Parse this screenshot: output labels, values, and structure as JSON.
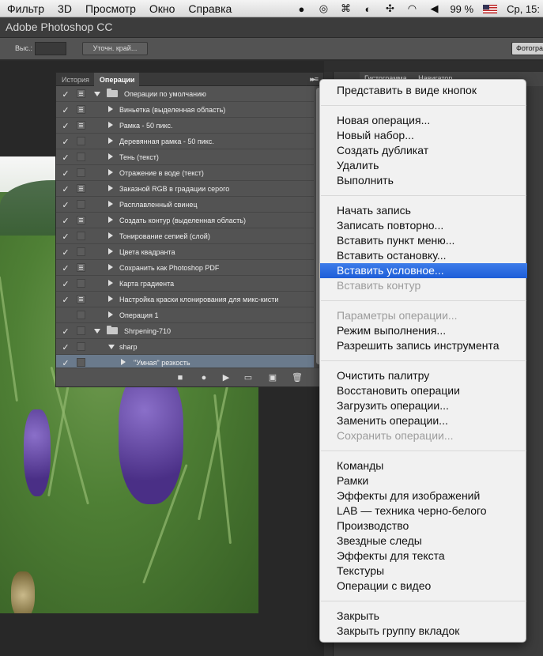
{
  "menubar": {
    "items": [
      "Фильтр",
      "3D",
      "Просмотр",
      "Окно",
      "Справка"
    ],
    "battery": "99 %",
    "clock": "Ср, 15:"
  },
  "app": {
    "title": "Adobe Photoshop CC",
    "options": {
      "height_label": "Выс.:",
      "refine_edge": "Уточн. край...",
      "right_button": "Фотогра"
    }
  },
  "right_panel": {
    "tabs": [
      "Гистограмма",
      "Навигатор"
    ]
  },
  "actions_panel": {
    "tabs": [
      "История",
      "Операции"
    ],
    "active_tab": "Операции",
    "rows": [
      {
        "label": "Операции по умолчанию",
        "kind": "set",
        "expanded": true,
        "check": "✓",
        "dialog": true
      },
      {
        "label": "Виньетка (выделенная область)",
        "kind": "action",
        "check": "✓",
        "dialog": true
      },
      {
        "label": "Рамка - 50 пикс.",
        "kind": "action",
        "check": "✓",
        "dialog": true
      },
      {
        "label": "Деревянная рамка - 50 пикс.",
        "kind": "action",
        "check": "✓",
        "dialog": false
      },
      {
        "label": "Тень (текст)",
        "kind": "action",
        "check": "✓",
        "dialog": false
      },
      {
        "label": "Отражение в воде (текст)",
        "kind": "action",
        "check": "✓",
        "dialog": false
      },
      {
        "label": "Заказной RGB в градации серого",
        "kind": "action",
        "check": "✓",
        "dialog": true
      },
      {
        "label": "Расплавленный свинец",
        "kind": "action",
        "check": "✓",
        "dialog": false
      },
      {
        "label": "Создать контур (выделенная область)",
        "kind": "action",
        "check": "✓",
        "dialog": true
      },
      {
        "label": "Тонирование сепией (слой)",
        "kind": "action",
        "check": "✓",
        "dialog": false
      },
      {
        "label": "Цвета квадранта",
        "kind": "action",
        "check": "✓",
        "dialog": false
      },
      {
        "label": "Сохранить как Photoshop PDF",
        "kind": "action",
        "check": "✓",
        "dialog": true
      },
      {
        "label": "Карта градиента",
        "kind": "action",
        "check": "✓",
        "dialog": false
      },
      {
        "label": "Настройка краски клонирования для микс-кисти",
        "kind": "action",
        "check": "✓",
        "dialog": true
      },
      {
        "label": "Операция 1",
        "kind": "action",
        "check": "",
        "dialog": false
      },
      {
        "label": "Shrpening-710",
        "kind": "set",
        "expanded": true,
        "check": "✓",
        "dialog": false
      },
      {
        "label": "sharp",
        "kind": "action",
        "expanded": true,
        "check": "✓",
        "dialog": false
      },
      {
        "label": "\"Умная\" резкость",
        "kind": "step",
        "check": "✓",
        "dialog": false,
        "selected": true
      }
    ]
  },
  "menu": {
    "items": [
      {
        "label": "Представить в виде кнопок"
      },
      {
        "sep": true
      },
      {
        "label": "Новая операция..."
      },
      {
        "label": "Новый набор..."
      },
      {
        "label": "Создать дубликат"
      },
      {
        "label": "Удалить"
      },
      {
        "label": "Выполнить"
      },
      {
        "sep": true
      },
      {
        "label": "Начать запись"
      },
      {
        "label": "Записать повторно..."
      },
      {
        "label": "Вставить пункт меню..."
      },
      {
        "label": "Вставить остановку..."
      },
      {
        "label": "Вставить условное...",
        "highlighted": true
      },
      {
        "label": "Вставить контур",
        "disabled": true
      },
      {
        "sep": true
      },
      {
        "label": "Параметры операции...",
        "disabled": true
      },
      {
        "label": "Режим выполнения..."
      },
      {
        "label": "Разрешить запись инструмента"
      },
      {
        "sep": true
      },
      {
        "label": "Очистить палитру"
      },
      {
        "label": "Восстановить операции"
      },
      {
        "label": "Загрузить операции..."
      },
      {
        "label": "Заменить операции..."
      },
      {
        "label": "Сохранить операции...",
        "disabled": true
      },
      {
        "sep": true
      },
      {
        "label": "Команды"
      },
      {
        "label": "Рамки"
      },
      {
        "label": "Эффекты для изображений"
      },
      {
        "label": "LAB — техника черно-белого"
      },
      {
        "label": "Производство"
      },
      {
        "label": "Звездные следы"
      },
      {
        "label": "Эффекты для текста"
      },
      {
        "label": "Текстуры"
      },
      {
        "label": "Операции с видео"
      },
      {
        "sep": true
      },
      {
        "label": "Закрыть"
      },
      {
        "label": "Закрыть группу вкладок"
      }
    ]
  },
  "colors": {
    "highlight": "#2a6ae0",
    "panel": "#535353"
  }
}
